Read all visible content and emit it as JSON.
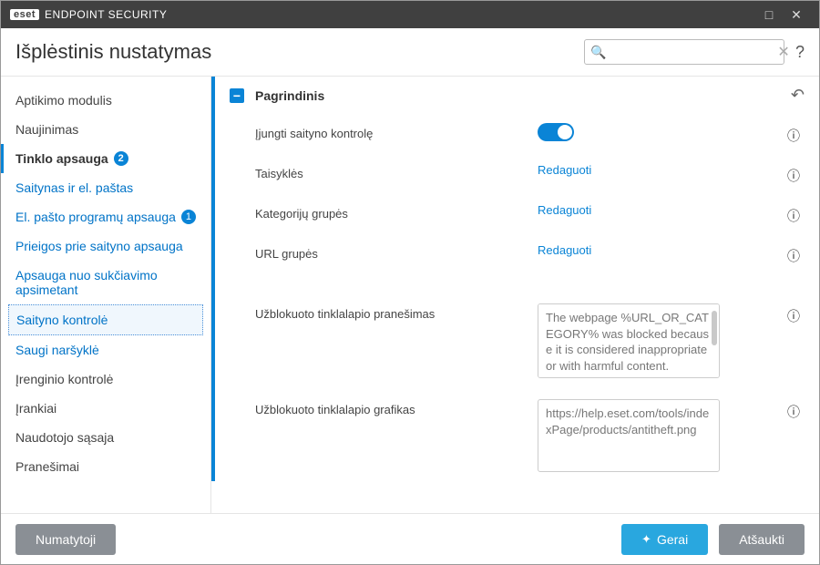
{
  "titlebar": {
    "brand_box": "eset",
    "product": "ENDPOINT SECURITY"
  },
  "header": {
    "title": "Išplėstinis nustatymas",
    "search_placeholder": ""
  },
  "sidebar": {
    "items": [
      {
        "label": "Aptikimo modulis",
        "link": false
      },
      {
        "label": "Naujinimas",
        "link": false
      },
      {
        "label": "Tinklo apsauga",
        "link": false,
        "bold": true,
        "badge": "2"
      },
      {
        "label": "Saitynas ir el. paštas",
        "link": true
      },
      {
        "label": "El. pašto programų apsauga",
        "link": true,
        "badge": "1"
      },
      {
        "label": "Prieigos prie saityno apsauga",
        "link": true
      },
      {
        "label": "Apsauga nuo sukčiavimo apsimetant",
        "link": true
      },
      {
        "label": "Saityno kontrolė",
        "link": true,
        "selected": true
      },
      {
        "label": "Saugi naršyklė",
        "link": true
      },
      {
        "label": "Įrenginio kontrolė",
        "link": false
      },
      {
        "label": "Įrankiai",
        "link": false
      },
      {
        "label": "Naudotojo sąsaja",
        "link": false
      },
      {
        "label": "Pranešimai",
        "link": false
      }
    ]
  },
  "panel": {
    "title": "Pagrindinis",
    "rows": {
      "enable": {
        "label": "Įjungti saityno kontrolę"
      },
      "rules": {
        "label": "Taisyklės",
        "action": "Redaguoti"
      },
      "catgroups": {
        "label": "Kategorijų grupės",
        "action": "Redaguoti"
      },
      "urlgroups": {
        "label": "URL grupės",
        "action": "Redaguoti"
      },
      "blockedmsg": {
        "label": "Užblokuoto tinklalapio pranešimas",
        "value": "The webpage %URL_OR_CATEGORY% was blocked because it is considered inappropriate or with harmful content."
      },
      "blockedimg": {
        "label": "Užblokuoto tinklalapio grafikas",
        "value": "https://help.eset.com/tools/indexPage/products/antitheft.png"
      }
    }
  },
  "footer": {
    "default": "Numatytoji",
    "ok": "Gerai",
    "cancel": "Atšaukti"
  }
}
